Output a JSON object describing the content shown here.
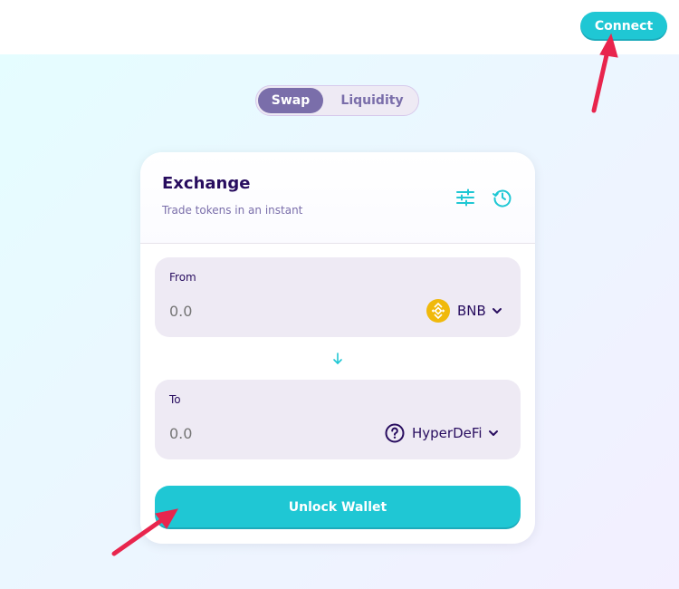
{
  "header": {
    "connect_label": "Connect"
  },
  "tabs": [
    {
      "label": "Swap",
      "active": true
    },
    {
      "label": "Liquidity",
      "active": false
    }
  ],
  "exchange": {
    "title": "Exchange",
    "subtitle": "Trade tokens in an instant",
    "icons": [
      "settings-sliders-icon",
      "history-clock-icon"
    ]
  },
  "from": {
    "label": "From",
    "amount_placeholder": "0.0",
    "token": "BNB",
    "token_icon": "bnb-coin-icon"
  },
  "to": {
    "label": "To",
    "amount_placeholder": "0.0",
    "token": "HyperDeFi",
    "token_icon": "question-circle-icon"
  },
  "swap_direction_icon": "arrow-down-icon",
  "unlock_label": "Unlock Wallet",
  "colors": {
    "primary": "#1fc7d4",
    "secondary": "#7a6eaa",
    "text": "#280d5f",
    "panel": "#eeeaf4",
    "annotation_arrow": "#e8254d",
    "bnb": "#f0b90b"
  }
}
